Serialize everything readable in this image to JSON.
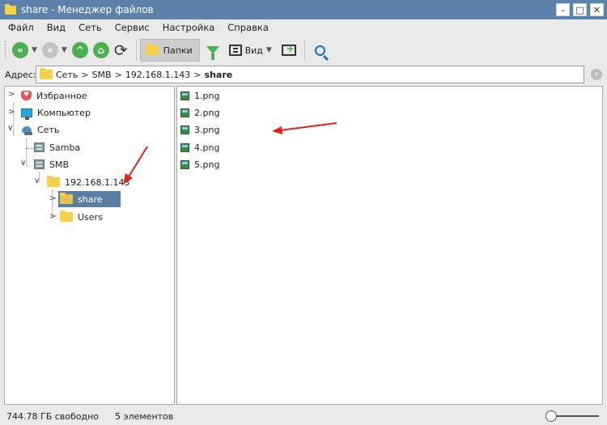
{
  "window": {
    "title": "share - Менеджер файлов",
    "buttons": {
      "minimize": "–",
      "maximize": "□",
      "close": "✕"
    }
  },
  "menu": [
    "Файл",
    "Вид",
    "Сеть",
    "Сервис",
    "Настройка",
    "Справка"
  ],
  "toolbar": {
    "folders_label": "Папки",
    "view_label": "Вид",
    "icons": [
      "back-icon",
      "forward-icon",
      "up-icon",
      "home-icon",
      "refresh-icon",
      "folder-icon",
      "filter-icon",
      "view-icon",
      "panel-icon",
      "search-icon"
    ]
  },
  "address": {
    "label": "Адрес:",
    "crumbs": [
      "Сеть",
      "SMB",
      "192.168.1.143",
      "share"
    ]
  },
  "tree": {
    "favorites": "Избранное",
    "computer": "Компьютер",
    "network": "Сеть",
    "samba": "Samba",
    "smb": "SMB",
    "host": "192.168.1.143",
    "share": "share",
    "users": "Users"
  },
  "files": [
    "1.png",
    "2.png",
    "3.png",
    "4.png",
    "5.png"
  ],
  "status": {
    "free": "744.78 ГБ свободно",
    "count": "5 элементов"
  },
  "colors": {
    "titlebar": "#5c82a9",
    "selection": "#5a7fa3",
    "annotation_arrow": "#e0201e"
  }
}
